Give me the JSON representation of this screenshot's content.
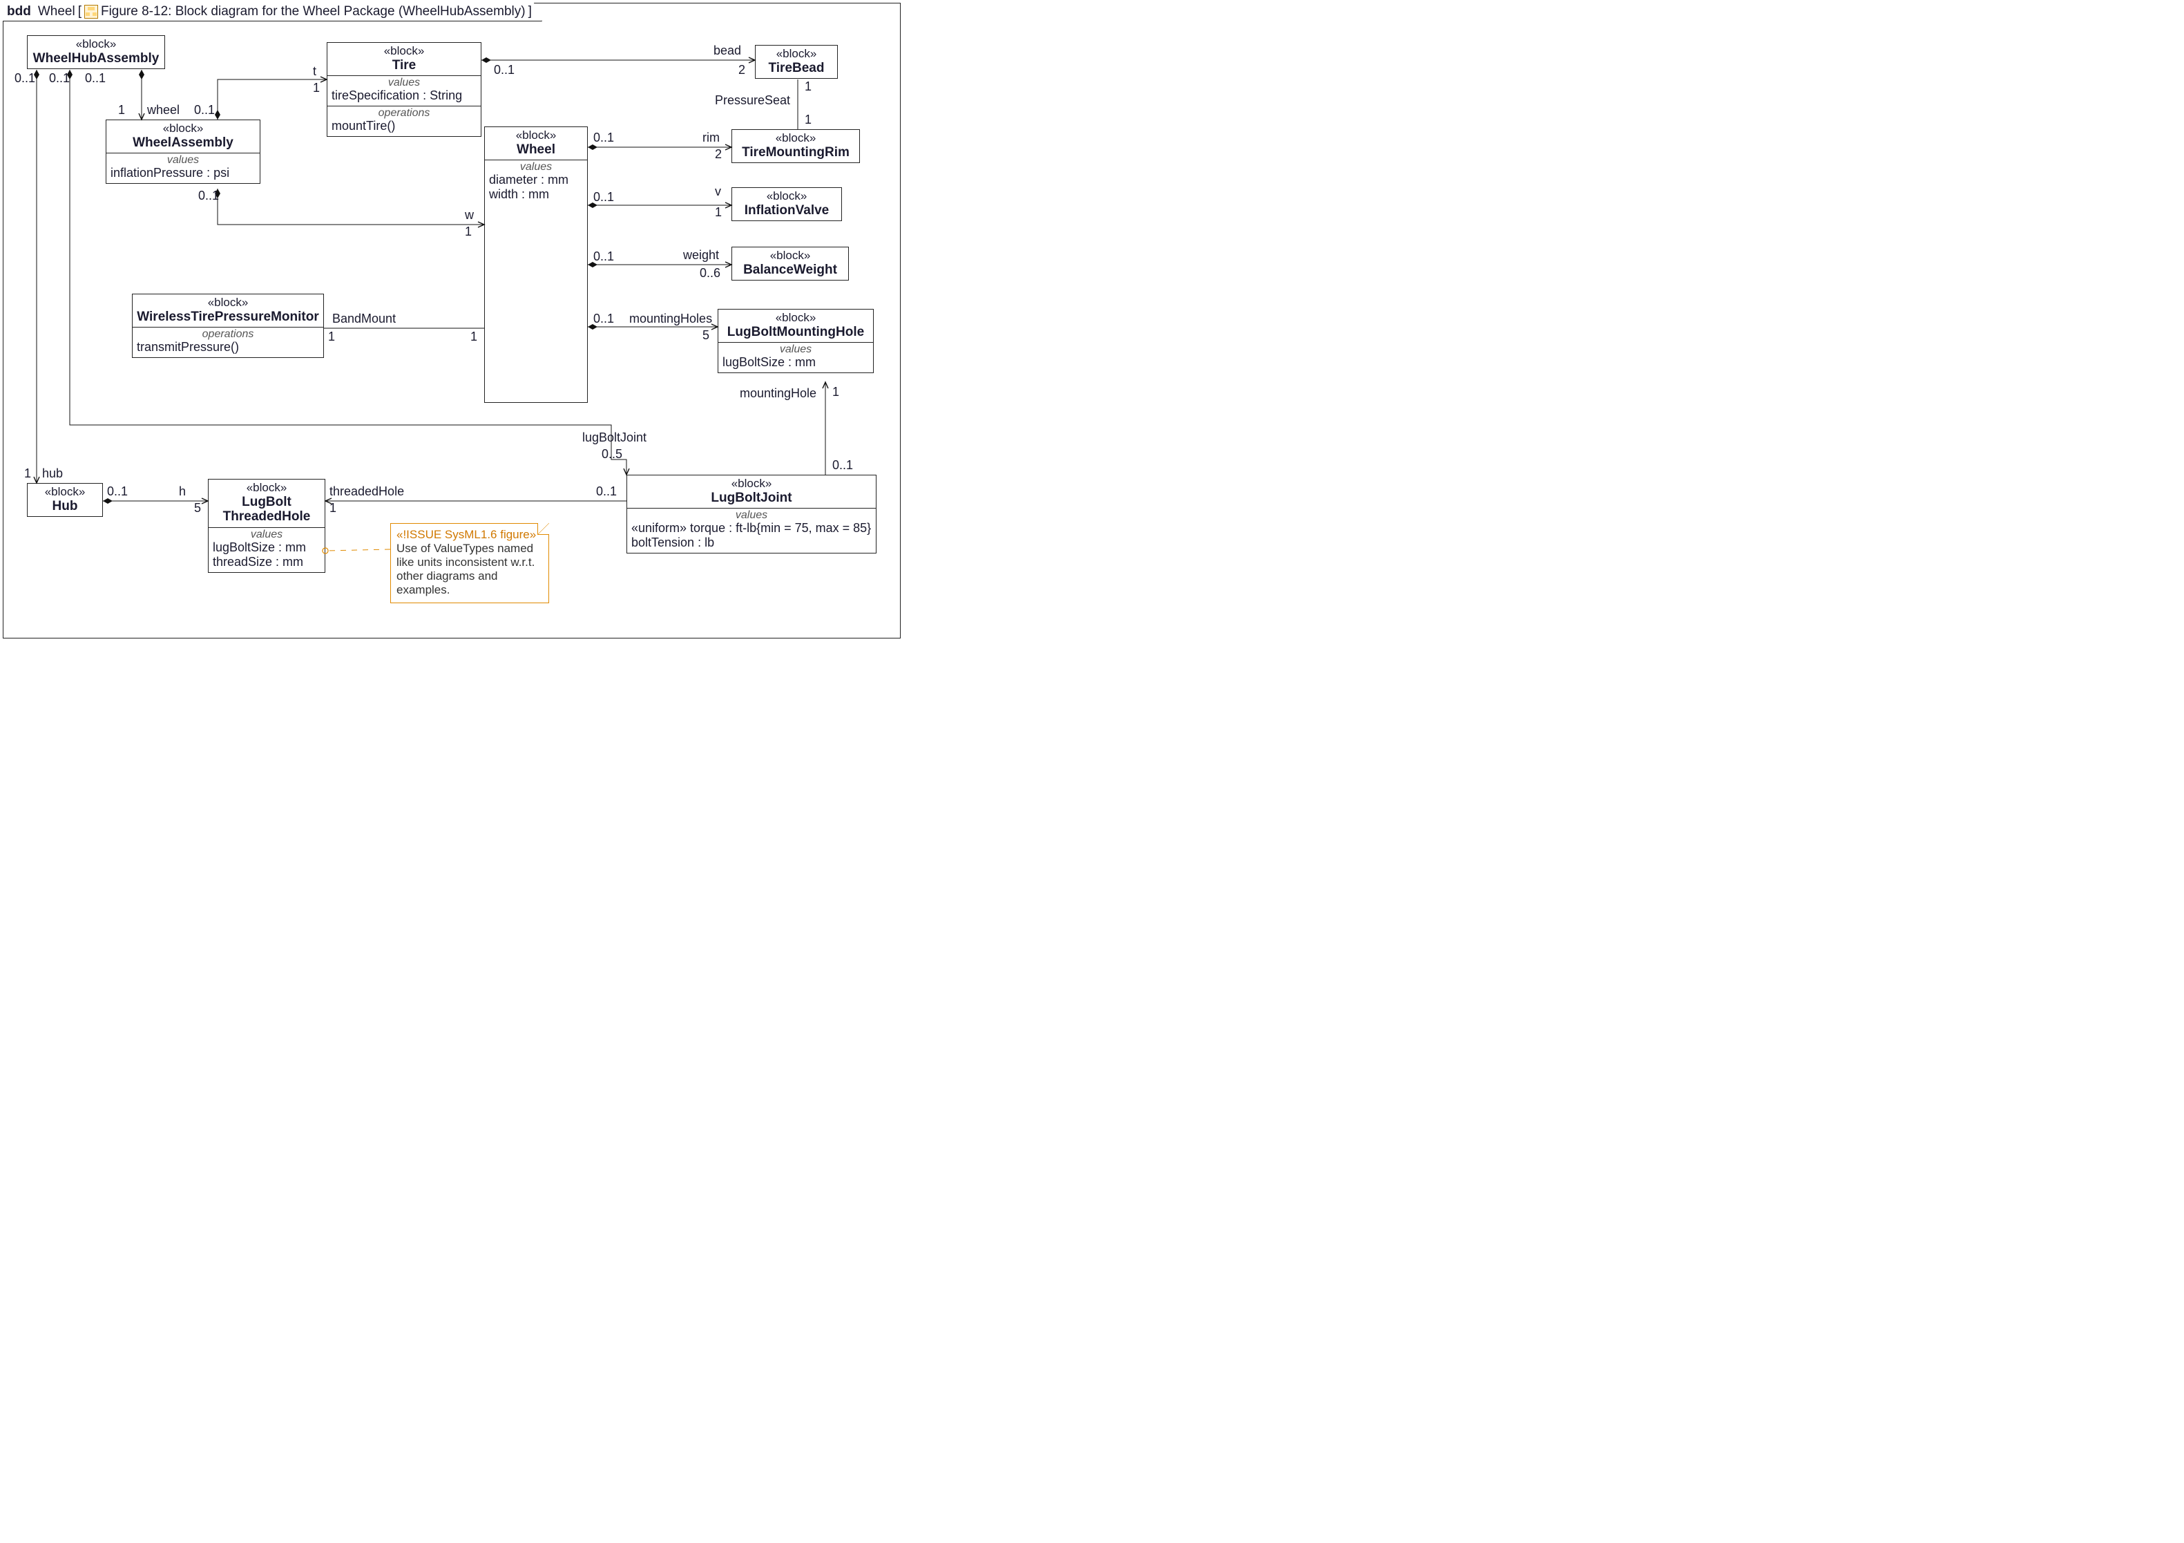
{
  "frame": {
    "kind": "bdd",
    "package": "Wheel",
    "title": "Figure 8-12: Block diagram for the Wheel Package (WheelHubAssembly)"
  },
  "blocks": {
    "wha": {
      "stereo": "«block»",
      "name": "WheelHubAssembly"
    },
    "wa": {
      "stereo": "«block»",
      "name": "WheelAssembly",
      "valuesLabel": "values",
      "v1": "inflationPressure : psi"
    },
    "tire": {
      "stereo": "«block»",
      "name": "Tire",
      "valuesLabel": "values",
      "v1": "tireSpecification : String",
      "opsLabel": "operations",
      "o1": "mountTire()"
    },
    "wheel": {
      "stereo": "«block»",
      "name": "Wheel",
      "valuesLabel": "values",
      "v1": "diameter : mm",
      "v2": "width : mm"
    },
    "bead": {
      "stereo": "«block»",
      "name": "TireBead"
    },
    "rim": {
      "stereo": "«block»",
      "name": "TireMountingRim"
    },
    "valve": {
      "stereo": "«block»",
      "name": "InflationValve"
    },
    "bw": {
      "stereo": "«block»",
      "name": "BalanceWeight"
    },
    "lbmh": {
      "stereo": "«block»",
      "name": "LugBoltMountingHole",
      "valuesLabel": "values",
      "v1": "lugBoltSize : mm"
    },
    "wtpm": {
      "stereo": "«block»",
      "name": "WirelessTirePressureMonitor",
      "opsLabel": "operations",
      "o1": "transmitPressure()"
    },
    "hub": {
      "stereo": "«block»",
      "name": "Hub"
    },
    "lbth": {
      "stereo": "«block»",
      "name": "LugBolt\nThreadedHole",
      "valuesLabel": "values",
      "v1": "lugBoltSize : mm",
      "v2": "threadSize : mm"
    },
    "lbj": {
      "stereo": "«block»",
      "name": "LugBoltJoint",
      "valuesLabel": "values",
      "v1": "«uniform» torque : ft-lb{min = 75, max = 85}",
      "v2": "boltTension : lb"
    }
  },
  "labels": {
    "wheelRole": "wheel",
    "m1": "1",
    "m01": "0..1",
    "tRole": "t",
    "wRole": "w",
    "hRole": "h",
    "vRole": "v",
    "hubRole": "hub",
    "beadRole": "bead",
    "rimRole": "rim",
    "weightRole": "weight",
    "mhRole": "mountingHoles",
    "threadedRole": "threadedHole",
    "mountingHoleRole": "mountingHole",
    "lugBoltJointRole": "lugBoltJoint",
    "bandMount": "BandMount",
    "pressureSeat": "PressureSeat",
    "m2": "2",
    "m5": "5",
    "m06": "0..6",
    "m05": "0..5"
  },
  "note": {
    "stereo": "«!ISSUE SysML1.6 figure»",
    "body": "Use of ValueTypes named like units inconsistent w.r.t. other diagrams and examples."
  },
  "chart_data": {
    "type": "block-definition-diagram",
    "package": "Wheel",
    "frame_title": "Figure 8-12: Block diagram for the Wheel Package (WheelHubAssembly)",
    "blocks": [
      {
        "name": "WheelHubAssembly"
      },
      {
        "name": "WheelAssembly",
        "values": [
          "inflationPressure : psi"
        ]
      },
      {
        "name": "Tire",
        "values": [
          "tireSpecification : String"
        ],
        "operations": [
          "mountTire()"
        ]
      },
      {
        "name": "Wheel",
        "values": [
          "diameter : mm",
          "width : mm"
        ]
      },
      {
        "name": "TireBead"
      },
      {
        "name": "TireMountingRim"
      },
      {
        "name": "InflationValve"
      },
      {
        "name": "BalanceWeight"
      },
      {
        "name": "LugBoltMountingHole",
        "values": [
          "lugBoltSize : mm"
        ]
      },
      {
        "name": "WirelessTirePressureMonitor",
        "operations": [
          "transmitPressure()"
        ]
      },
      {
        "name": "Hub"
      },
      {
        "name": "LugBoltThreadedHole",
        "values": [
          "lugBoltSize : mm",
          "threadSize : mm"
        ]
      },
      {
        "name": "LugBoltJoint",
        "values": [
          "«uniform» torque : ft-lb{min = 75, max = 85}",
          "boltTension : lb"
        ]
      }
    ],
    "relationships": [
      {
        "whole": "WheelHubAssembly",
        "part": "WheelAssembly",
        "role": "wheel",
        "wholeMult": "0..1",
        "partMult": "1",
        "kind": "composition"
      },
      {
        "whole": "WheelHubAssembly",
        "part": "Hub",
        "role": "hub",
        "wholeMult": "0..1",
        "partMult": "1",
        "kind": "composition"
      },
      {
        "whole": "WheelHubAssembly",
        "part": "LugBoltJoint",
        "role": "lugBoltJoint",
        "wholeMult": "0..1",
        "partMult": "0..5",
        "kind": "composition"
      },
      {
        "whole": "WheelAssembly",
        "part": "Tire",
        "role": "t",
        "wholeMult": "0..1",
        "partMult": "1",
        "kind": "composition"
      },
      {
        "whole": "WheelAssembly",
        "part": "Wheel",
        "role": "w",
        "wholeMult": "0..1",
        "partMult": "1",
        "kind": "composition"
      },
      {
        "whole": "Tire",
        "part": "TireBead",
        "role": "bead",
        "wholeMult": "0..1",
        "partMult": "2",
        "kind": "composition"
      },
      {
        "whole": "Wheel",
        "part": "TireMountingRim",
        "role": "rim",
        "wholeMult": "0..1",
        "partMult": "2",
        "kind": "composition"
      },
      {
        "whole": "Wheel",
        "part": "InflationValve",
        "role": "v",
        "wholeMult": "0..1",
        "partMult": "1",
        "kind": "composition"
      },
      {
        "whole": "Wheel",
        "part": "BalanceWeight",
        "role": "weight",
        "wholeMult": "0..1",
        "partMult": "0..6",
        "kind": "composition"
      },
      {
        "whole": "Wheel",
        "part": "LugBoltMountingHole",
        "role": "mountingHoles",
        "wholeMult": "0..1",
        "partMult": "5",
        "kind": "composition"
      },
      {
        "whole": "Hub",
        "part": "LugBoltThreadedHole",
        "role": "h",
        "wholeMult": "0..1",
        "partMult": "5",
        "kind": "composition"
      },
      {
        "a": "WirelessTirePressureMonitor",
        "b": "Wheel",
        "name": "BandMount",
        "aMult": "1",
        "bMult": "1",
        "kind": "association"
      },
      {
        "a": "TireBead",
        "b": "TireMountingRim",
        "name": "PressureSeat",
        "aMult": "1",
        "bMult": "1",
        "kind": "association"
      },
      {
        "a": "LugBoltJoint",
        "b": "LugBoltThreadedHole",
        "role": "threadedHole",
        "aMult": "0..1",
        "bMult": "1",
        "kind": "association-nav"
      },
      {
        "a": "LugBoltJoint",
        "b": "LugBoltMountingHole",
        "role": "mountingHole",
        "aMult": "0..1",
        "bMult": "1",
        "kind": "association-nav"
      }
    ],
    "note": {
      "stereotype": "«!ISSUE SysML1.6 figure»",
      "text": "Use of ValueTypes named like units inconsistent w.r.t. other diagrams and examples."
    }
  }
}
